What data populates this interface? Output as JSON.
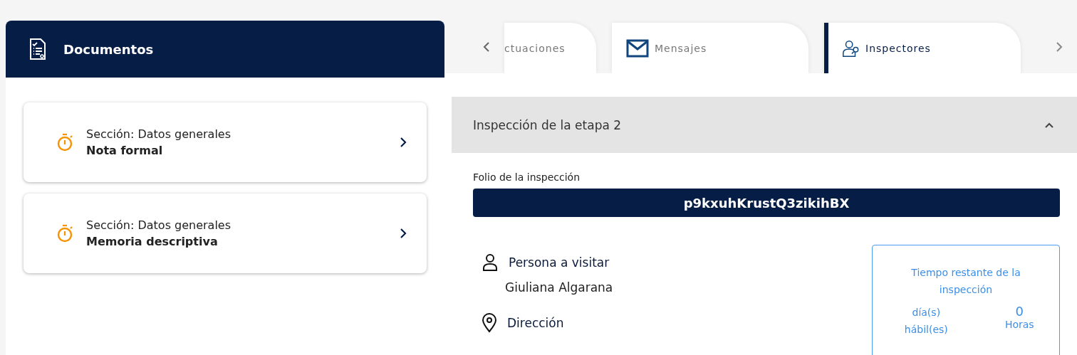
{
  "documents": {
    "title": "Documentos",
    "items": [
      {
        "section": "Sección: Datos generales",
        "name": "Nota formal"
      },
      {
        "section": "Sección: Datos generales",
        "name": "Memoria descriptiva"
      }
    ]
  },
  "tabs": [
    {
      "kind": "partial",
      "label": "ctuaciones",
      "selected": false
    },
    {
      "kind": "messages",
      "label": "Mensajes",
      "selected": false
    },
    {
      "kind": "inspectors",
      "label": "Inspectores",
      "selected": true
    }
  ],
  "accordion": {
    "title": "Inspección de la etapa 2",
    "expanded": true
  },
  "folio": {
    "label": "Folio de la inspección",
    "value": "p9kxuhKrustQ3zikihBX"
  },
  "fields": [
    {
      "kind": "person",
      "label": "Persona a visitar",
      "value": "Giuliana Algarana"
    },
    {
      "kind": "location",
      "label": "Dirección"
    }
  ],
  "timer": {
    "title": "Tiempo restante de la inspección",
    "days_label": "día(s) hábil(es)",
    "hours": "0",
    "hours_label": "Horas"
  }
}
